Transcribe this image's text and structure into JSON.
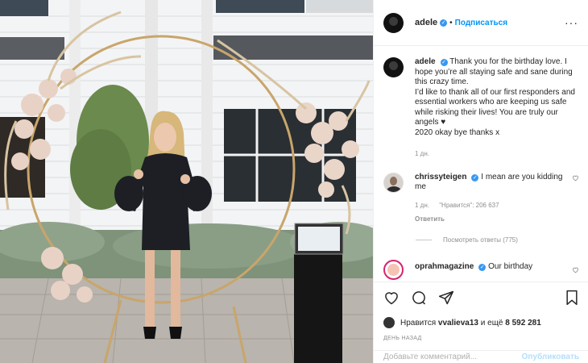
{
  "post": {
    "author": "adele",
    "follow_label": "Подписаться",
    "more_icon": "more-icon",
    "caption": "Thank you for the birthday love. I hope you’re all staying safe and sane during this crazy time.\nI’d like to thank all of our first responders and essential workers who are keeping us safe while risking their lives! You are truly our angels ♥\n2020 okay bye thanks x",
    "caption_time": "1 дн."
  },
  "comments": [
    {
      "user": "chrissyteigen",
      "text": "I mean are you kidding me",
      "time": "1 дн.",
      "likes": "\"Нравится\": 206 637",
      "reply_label": "Ответить",
      "view_replies": "Посмотреть ответы (775)"
    },
    {
      "user": "oprahmagazine",
      "text": "Our birthday"
    }
  ],
  "actions": {
    "liked_by_prefix": "Нравится",
    "liked_by_user": "vvalieva13",
    "liked_by_more": "и ещё",
    "likes_count": "8 592 281",
    "posted_ago": "ДЕНЬ НАЗАД",
    "comment_placeholder": "Добавьте комментарий...",
    "publish_label": "Опубликовать"
  },
  "colors": {
    "accent": "#0095f6",
    "verified": "#3897f0",
    "muted": "#8e8e8e"
  }
}
